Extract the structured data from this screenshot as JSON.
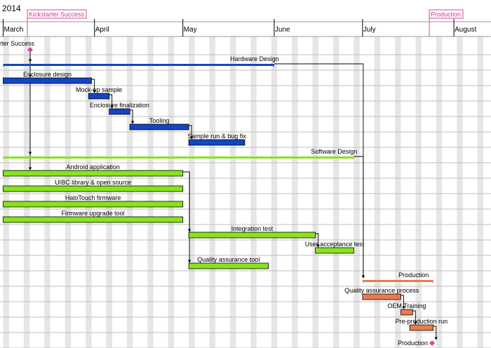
{
  "timeline": {
    "year": "2014",
    "months": [
      "March",
      "April",
      "May",
      "June",
      "July",
      "August"
    ],
    "header_milestones": [
      "Kickstarter Success",
      "Production"
    ],
    "milestone_color": "#e0409a"
  },
  "colors": {
    "hardware": "#1545c2",
    "software": "#88e31c",
    "production": "#ea7a50",
    "weekend_shade": "#e6e6e6",
    "row_line": "#bfbfbf"
  },
  "tasks": [
    {
      "name": "Kickstarter Success",
      "type": "milestone",
      "start": "2014-03-01"
    },
    {
      "name": "Hardware Design",
      "type": "summary",
      "group": "hardware",
      "start": "2014-03-01",
      "end": "2014-05-31"
    },
    {
      "name": "Enclosure design",
      "type": "task",
      "group": "hardware",
      "start": "2014-03-01",
      "end": "2014-03-30"
    },
    {
      "name": "Mock-up sample",
      "type": "task",
      "group": "hardware",
      "start": "2014-03-30",
      "end": "2014-04-05"
    },
    {
      "name": "Enclosure finalization",
      "type": "task",
      "group": "hardware",
      "start": "2014-04-06",
      "end": "2014-04-12"
    },
    {
      "name": "Tooling",
      "type": "task",
      "group": "hardware",
      "start": "2014-04-13",
      "end": "2014-05-02"
    },
    {
      "name": "Sample run & bug fix",
      "type": "task",
      "group": "hardware",
      "start": "2014-05-03",
      "end": "2014-05-21"
    },
    {
      "name": "Software Design",
      "type": "summary",
      "group": "software",
      "start": "2014-03-01",
      "end": "2014-06-27"
    },
    {
      "name": "Android application",
      "type": "task",
      "group": "software",
      "start": "2014-03-01",
      "end": "2014-04-30"
    },
    {
      "name": "UIBC library & open source",
      "type": "task",
      "group": "software",
      "start": "2014-03-01",
      "end": "2014-04-30"
    },
    {
      "name": "HaloTouch firmware",
      "type": "task",
      "group": "software",
      "start": "2014-03-01",
      "end": "2014-04-30"
    },
    {
      "name": "Firmware upgrade tool",
      "type": "task",
      "group": "software",
      "start": "2014-03-01",
      "end": "2014-04-30"
    },
    {
      "name": "Integration test",
      "type": "task",
      "group": "software",
      "start": "2014-05-03",
      "end": "2014-06-14"
    },
    {
      "name": "User acceptance test",
      "type": "task",
      "group": "software",
      "start": "2014-06-15",
      "end": "2014-06-27"
    },
    {
      "name": "Quality assurance tool",
      "type": "task",
      "group": "software",
      "start": "2014-05-03",
      "end": "2014-05-29"
    },
    {
      "name": "Production",
      "type": "summary",
      "group": "production",
      "start": "2014-07-01",
      "end": "2014-07-24"
    },
    {
      "name": "Quality assurance process",
      "type": "task",
      "group": "production",
      "start": "2014-07-01",
      "end": "2014-07-13"
    },
    {
      "name": "OEM Training",
      "type": "task",
      "group": "production",
      "start": "2014-07-14",
      "end": "2014-07-17"
    },
    {
      "name": "Pre-production run",
      "type": "task",
      "group": "production",
      "start": "2014-07-17",
      "end": "2014-07-24"
    },
    {
      "name": "Production",
      "type": "milestone",
      "start": "2014-07-25"
    }
  ],
  "dependencies": [
    [
      0,
      1
    ],
    [
      0,
      2
    ],
    [
      0,
      7
    ],
    [
      0,
      8
    ],
    [
      2,
      3
    ],
    [
      3,
      4
    ],
    [
      4,
      5
    ],
    [
      5,
      6
    ],
    [
      8,
      12
    ],
    [
      8,
      14
    ],
    [
      12,
      13
    ],
    [
      1,
      15
    ],
    [
      7,
      15
    ],
    [
      16,
      17
    ],
    [
      17,
      18
    ],
    [
      18,
      19
    ]
  ]
}
